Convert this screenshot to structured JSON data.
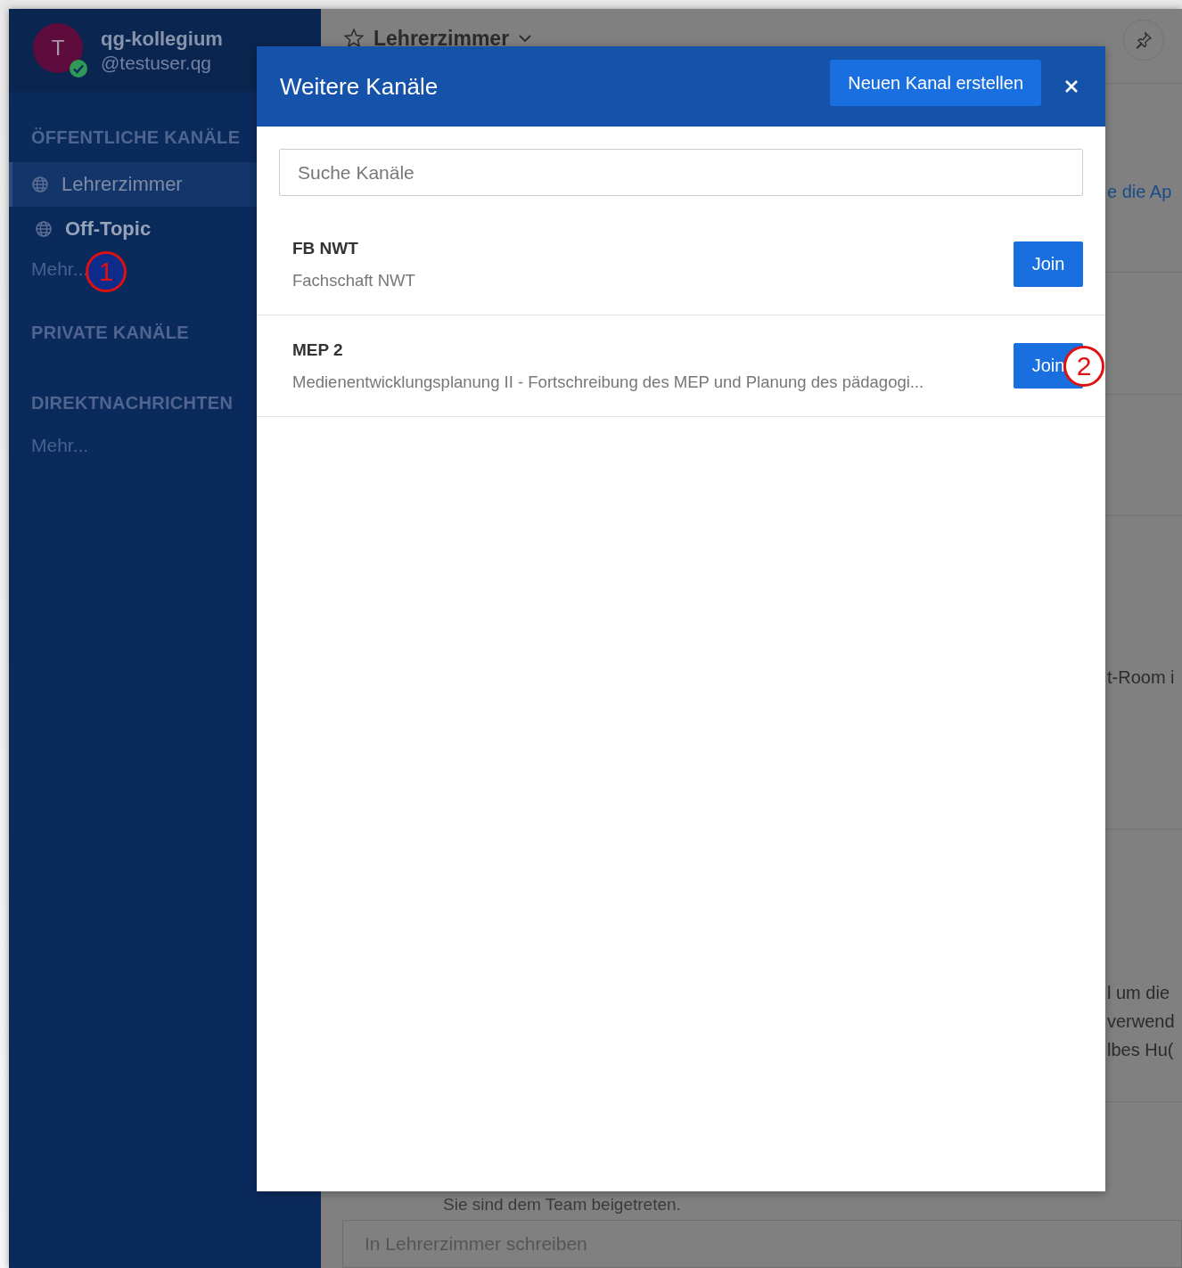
{
  "sidebar": {
    "team_name": "qg-kollegium",
    "username": "@testuser.qg",
    "avatar_letter": "T",
    "online": true,
    "sections": [
      {
        "title": "ÖFFENTLICHE KANÄLE",
        "items": [
          {
            "kind": "channel",
            "label": "Lehrerzimmer",
            "selected": true,
            "unread": false
          },
          {
            "kind": "channel",
            "label": "Off-Topic",
            "selected": false,
            "unread": true
          },
          {
            "kind": "more",
            "label": "Mehr...",
            "annotation": "1"
          }
        ]
      },
      {
        "title": "PRIVATE KANÄLE"
      },
      {
        "title": "DIREKTNACHRICHTEN",
        "items": [
          {
            "kind": "more",
            "label": "Mehr..."
          }
        ]
      }
    ]
  },
  "channel_header": {
    "name": "Lehrerzimmer",
    "favorite": false
  },
  "feed_fragments": [
    {
      "kind": "link",
      "text": "e die Ap"
    },
    {
      "kind": "text",
      "text": "t-Room i"
    },
    {
      "kind": "text",
      "text": "l um die"
    },
    {
      "kind": "text",
      "text": "verwend"
    },
    {
      "kind": "text",
      "text": "lbes Hu("
    }
  ],
  "system_message": "Sie sind dem Team beigetreten.",
  "composer": {
    "placeholder": "In Lehrerzimmer schreiben"
  },
  "modal": {
    "title": "Weitere Kanäle",
    "create_button": "Neuen Kanal erstellen",
    "search": {
      "placeholder": "Suche Kanäle"
    },
    "channels": [
      {
        "name": "FB NWT",
        "purpose": "Fachschaft NWT",
        "button": "Join"
      },
      {
        "name": "MEP 2",
        "purpose": "Medienentwicklungsplanung II - Fortschreibung des MEP und Planung des pädagogi...",
        "button": "Join",
        "annotation": "2"
      }
    ]
  }
}
